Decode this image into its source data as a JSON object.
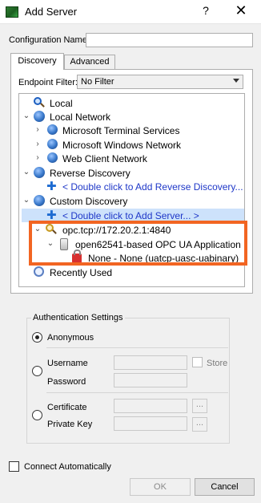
{
  "window": {
    "title": "Add Server",
    "help": "?",
    "close": "✕"
  },
  "config": {
    "label": "Configuration Name",
    "value": ""
  },
  "tabs": [
    {
      "label": "Discovery",
      "active": true
    },
    {
      "label": "Advanced",
      "active": false
    }
  ],
  "endpoint_filter": {
    "label": "Endpoint Filter:",
    "value": "No Filter"
  },
  "tree": {
    "local": "Local",
    "local_network": "Local Network",
    "local_network_children": [
      "Microsoft Terminal Services",
      "Microsoft Windows Network",
      "Web Client Network"
    ],
    "reverse_discovery": "Reverse Discovery",
    "reverse_add": "< Double click to Add Reverse Discovery...",
    "custom_discovery": "Custom Discovery",
    "custom_add": "< Double click to Add Server... >",
    "server_url": "opc.tcp://172.20.2.1:4840",
    "application": "open62541-based OPC UA Application",
    "endpoint": "None - None (uatcp-uasc-uabinary)",
    "recently_used": "Recently Used"
  },
  "auth": {
    "title": "Authentication Settings",
    "anonymous": "Anonymous",
    "username": "Username",
    "password": "Password",
    "store": "Store",
    "certificate": "Certificate",
    "private_key": "Private Key",
    "browse": "..."
  },
  "connect_automatically": "Connect Automatically",
  "buttons": {
    "ok": "OK",
    "cancel": "Cancel"
  },
  "colors": {
    "highlight": "#f26522",
    "link": "#1e37c8",
    "selection": "#cde2fb"
  }
}
